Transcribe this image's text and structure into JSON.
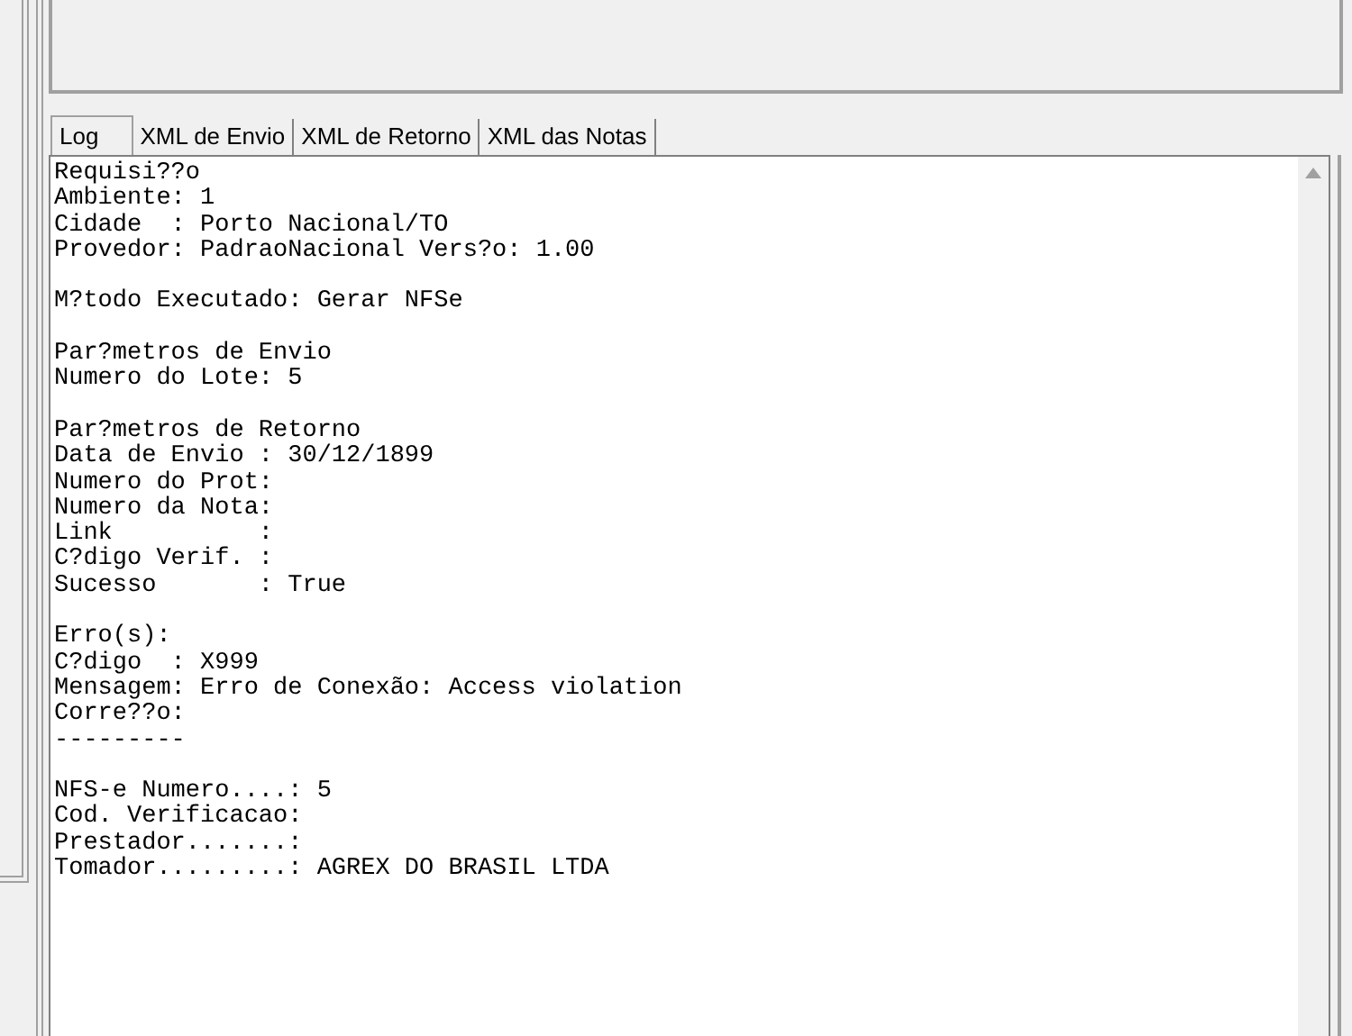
{
  "tabs": [
    {
      "label": "Log",
      "selected": true
    },
    {
      "label": "XML de Envio",
      "selected": false
    },
    {
      "label": "XML de Retorno",
      "selected": false
    },
    {
      "label": "XML das Notas",
      "selected": false
    }
  ],
  "log": {
    "paragraphs": [
      [
        "Requisi??o",
        "Ambiente: 1",
        "Cidade  : Porto Nacional/TO",
        "Provedor: PadraoNacional Vers?o: 1.00"
      ],
      [
        "M?todo Executado: Gerar NFSe"
      ],
      [
        "Par?metros de Envio",
        "Numero do Lote: 5"
      ],
      [
        "Par?metros de Retorno",
        "Data de Envio : 30/12/1899",
        "Numero do Prot:",
        "Numero da Nota:",
        "Link          :",
        "C?digo Verif. :",
        "Sucesso       : True"
      ],
      [
        "Erro(s):",
        "C?digo  : X999",
        "Mensagem: Erro de Conexão: Access violation",
        "Corre??o:",
        "---------"
      ],
      [
        "NFS-e Numero....: 5",
        "Cod. Verificacao:",
        "Prestador.......:",
        "Tomador.........: AGREX DO BRASIL LTDA"
      ]
    ]
  }
}
